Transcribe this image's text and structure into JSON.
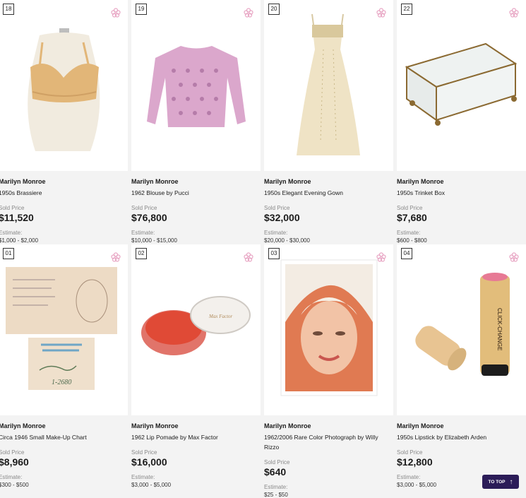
{
  "lots": [
    {
      "lot": "18",
      "artist": "Marilyn Monroe",
      "title": "1950s Brassiere",
      "sold_label": "Sold Price",
      "price": "$11,520",
      "estimate_label": "Estimate:",
      "estimate": "$1,000 - $2,000",
      "image": "brassiere"
    },
    {
      "lot": "19",
      "artist": "Marilyn Monroe",
      "title": "1962 Blouse by Pucci",
      "sold_label": "Sold Price",
      "price": "$76,800",
      "estimate_label": "Estimate:",
      "estimate": "$10,000 - $15,000",
      "image": "blouse"
    },
    {
      "lot": "20",
      "artist": "Marilyn Monroe",
      "title": "1950s Elegant Evening Gown",
      "sold_label": "Sold Price",
      "price": "$32,000",
      "estimate_label": "Estimate:",
      "estimate": "$20,000 - $30,000",
      "image": "gown"
    },
    {
      "lot": "22",
      "artist": "Marilyn Monroe",
      "title": "1950s Trinket Box",
      "sold_label": "Sold Price",
      "price": "$7,680",
      "estimate_label": "Estimate:",
      "estimate": "$600 - $800",
      "image": "trinket-box"
    },
    {
      "lot": "01",
      "artist": "Marilyn Monroe",
      "title": "Circa 1946 Small Make-Up Chart",
      "sold_label": "Sold Price",
      "price": "$8,960",
      "estimate_label": "Estimate:",
      "estimate": "$300 - $500",
      "image": "makeup-chart"
    },
    {
      "lot": "02",
      "artist": "Marilyn Monroe",
      "title": "1962 Lip Pomade by Max Factor",
      "sold_label": "Sold Price",
      "price": "$16,000",
      "estimate_label": "Estimate:",
      "estimate": "$3,000 - $5,000",
      "image": "lip-pomade"
    },
    {
      "lot": "03",
      "artist": "Marilyn Monroe",
      "title": "1962/2006 Rare Color Photograph by Willy Rizzo",
      "sold_label": "Sold Price",
      "price": "$640",
      "estimate_label": "Estimate:",
      "estimate": "$25 - $50",
      "image": "photograph"
    },
    {
      "lot": "04",
      "artist": "Marilyn Monroe",
      "title": "1950s Lipstick by Elizabeth Arden",
      "sold_label": "Sold Price",
      "price": "$12,800",
      "estimate_label": "Estimate:",
      "estimate": "$3,000 - $5,000",
      "image": "lipstick"
    }
  ],
  "image_text": {
    "chart_note": "1-2680",
    "pomade_brand": "Max Factor",
    "lipstick_text": "CLICK-CHANGE"
  },
  "to_top_label": "TO TOP",
  "colors": {
    "favorite": "#e8a6c4",
    "to_top_bg": "#2b1c58",
    "card_bg": "#ffffff",
    "page_bg": "#f3f3f3"
  }
}
